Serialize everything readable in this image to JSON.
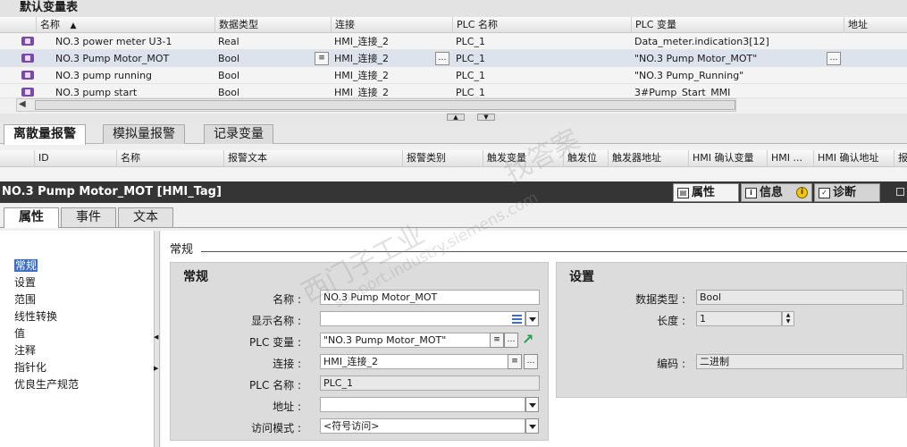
{
  "tag_table": {
    "title": "默认变量表",
    "columns": [
      "名称",
      "数据类型",
      "连接",
      "PLC 名称",
      "PLC 变量",
      "地址"
    ],
    "sort_indicator": "▲",
    "rows": [
      {
        "name": "NO.3 power meter U3-1",
        "type": "Real",
        "connection": "HMI_连接_2",
        "plc_name": "PLC_1",
        "plc_tag": "Data_meter.indication3[12]",
        "address": ""
      },
      {
        "name": "NO.3 Pump Motor_MOT",
        "type": "Bool",
        "connection": "HMI_连接_2",
        "plc_name": "PLC_1",
        "plc_tag": "\"NO.3 Pump Motor_MOT\"",
        "address": ""
      },
      {
        "name": "NO.3 pump running",
        "type": "Bool",
        "connection": "HMI_连接_2",
        "plc_name": "PLC_1",
        "plc_tag": "\"NO.3 Pump_Running\"",
        "address": ""
      },
      {
        "name": "NO.3 pump start",
        "type": "Bool",
        "connection": "HMI_连接_2",
        "plc_name": "PLC_1",
        "plc_tag": "3#Pump_Start_MMI",
        "address": ""
      }
    ]
  },
  "alarm_tabs": [
    "离散量报警",
    "模拟量报警",
    "记录变量"
  ],
  "alarm_columns": [
    "ID",
    "名称",
    "报警文本",
    "报警类别",
    "触发变量",
    "触发位",
    "触发器地址",
    "HMI 确认变量",
    "HMI ...",
    "HMI 确认地址",
    "报"
  ],
  "inspector": {
    "title": "NO.3 Pump Motor_MOT [HMI_Tag]",
    "tabs": [
      {
        "label": "属性",
        "icon": "properties-icon"
      },
      {
        "label": "信息",
        "icon": "info-icon"
      },
      {
        "label": "诊断",
        "icon": "diagnostics-icon"
      }
    ],
    "subtabs": [
      "属性",
      "事件",
      "文本"
    ],
    "nav": [
      "常规",
      "设置",
      "范围",
      "线性转换",
      "值",
      "注释",
      "指针化",
      "优良生产规范"
    ],
    "section_title": "常规",
    "general": {
      "title": "常规",
      "name_label": "名称",
      "name_value": "NO.3 Pump Motor_MOT",
      "display_name_label": "显示名称",
      "display_name_value": "",
      "plc_tag_label": "PLC 变量",
      "plc_tag_value": "\"NO.3 Pump Motor_MOT\"",
      "connection_label": "连接",
      "connection_value": "HMI_连接_2",
      "plc_name_label": "PLC 名称",
      "plc_name_value": "PLC_1",
      "address_label": "地址",
      "address_value": "",
      "access_label": "访问模式",
      "access_value": "<符号访问>"
    },
    "settings": {
      "title": "设置",
      "datatype_label": "数据类型",
      "datatype_value": "Bool",
      "length_label": "长度",
      "length_value": "1",
      "encoding_label": "编码",
      "encoding_value": "二进制"
    }
  },
  "watermark": {
    "line1": "西门子工业",
    "line2": "support.industry.siemens.com",
    "line3": "找答案"
  }
}
